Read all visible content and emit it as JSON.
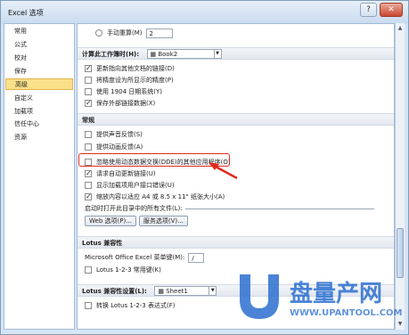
{
  "window": {
    "title": "Excel 选项",
    "btn_help": "?",
    "btn_close": "✕"
  },
  "sidebar": {
    "items": [
      {
        "label": "常用"
      },
      {
        "label": "公式"
      },
      {
        "label": "校对"
      },
      {
        "label": "保存"
      },
      {
        "label": "高级"
      },
      {
        "label": "自定义"
      },
      {
        "label": "加载项"
      },
      {
        "label": "信任中心"
      },
      {
        "label": "资源"
      }
    ],
    "selected_index": 4
  },
  "content": {
    "manual_recalc": {
      "label": "手动重算(M)",
      "value": "2"
    },
    "workbook_section": {
      "title": "计算此工作簿时(H):",
      "workbook": "Book2"
    },
    "workbook_options": [
      {
        "label": "更新指向其他文档的链接(D)",
        "checked": true
      },
      {
        "label": "将精度设为所显示的精度(P)",
        "checked": false
      },
      {
        "label": "使用 1904 日期系统(Y)",
        "checked": false
      },
      {
        "label": "保存外部链接数据(X)",
        "checked": true
      }
    ],
    "general_section": {
      "title": "常规"
    },
    "general_options": [
      {
        "label": "提供声音反馈(S)",
        "checked": false
      },
      {
        "label": "提供动画反馈(A)",
        "checked": false
      },
      {
        "label": "忽略使用动态数据交换(DDE)的其他应用程序(O)",
        "checked": false
      },
      {
        "label": "请求自动更新链接(U)",
        "checked": true
      },
      {
        "label": "显示加载项用户接口错误(U)",
        "checked": false
      },
      {
        "label": "缩放内容以适应 A4 或 8.5 x 11\" 纸张大小(A)",
        "checked": true
      }
    ],
    "startup_label": "启动时打开此目录中的所有文件(L):",
    "web_options_button": "Web 选项(P)...",
    "service_options_button": "服务选项(V)...",
    "lotus_section": {
      "title": "Lotus 兼容性"
    },
    "lotus_menu_key": {
      "label": "Microsoft Office Excel 菜单键(M):",
      "value": "/"
    },
    "lotus_nav_keys": {
      "label": "Lotus 1-2-3 常用键(K)",
      "checked": false
    },
    "lotus_settings_section": {
      "title": "Lotus 兼容性设置(L):",
      "sheet": "Sheet1"
    },
    "lotus_formula": {
      "label": "转换 Lotus 1-2-3 表达式(F)",
      "checked": false
    }
  },
  "watermark": {
    "text": "盘量产网",
    "url": "WWW.UPANTOOL.COM"
  },
  "colors": {
    "selected_bg": "#fbe08a",
    "highlight": "#e02a1e",
    "watermark_blue": "#2c6fcf"
  }
}
